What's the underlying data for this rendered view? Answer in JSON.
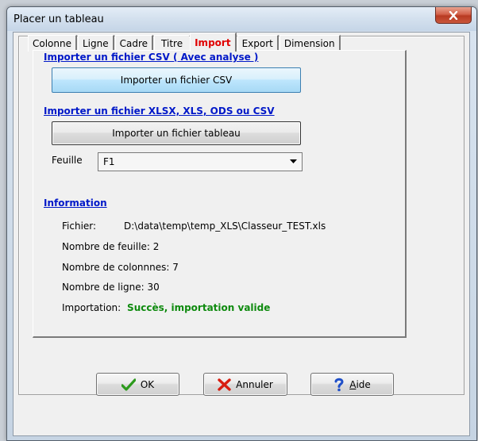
{
  "window": {
    "title": "Placer un tableau",
    "close_glyph": "x"
  },
  "tabs": [
    {
      "label": "Colonne",
      "active": false
    },
    {
      "label": "Ligne",
      "active": false
    },
    {
      "label": "Cadre",
      "active": false
    },
    {
      "label": "Titre",
      "active": false
    },
    {
      "label": "Import",
      "active": true
    },
    {
      "label": "Export",
      "active": false
    },
    {
      "label": "Dimension",
      "active": false
    }
  ],
  "import": {
    "csv_section_title": "Importer un fichier CSV ( Avec analyse )",
    "csv_button_label": "Importer un fichier CSV",
    "table_section_title": "Importer un fichier XLSX, XLS, ODS ou CSV",
    "table_button_label": "Importer un fichier tableau",
    "sheet_label": "Feuille",
    "sheet_selected": "F1"
  },
  "information": {
    "title": "Information",
    "file_label": "Fichier:",
    "file_path": "D:\\data\\temp\\temp_XLS\\Classeur_TEST.xls",
    "sheet_count": "Nombre de feuille: 2",
    "column_count": "Nombre de colonnnes: 7",
    "row_count": "Nombre de ligne: 30",
    "import_label": "Importation:",
    "import_status": "Succès, importation valide",
    "status_color": "#0e8a0e"
  },
  "footer": {
    "ok_label": "OK",
    "cancel_label": "Annuler",
    "help_label_first": "A",
    "help_label_rest": "ide"
  },
  "colors": {
    "section_link": "#0018c8",
    "active_tab": "#e00000"
  }
}
